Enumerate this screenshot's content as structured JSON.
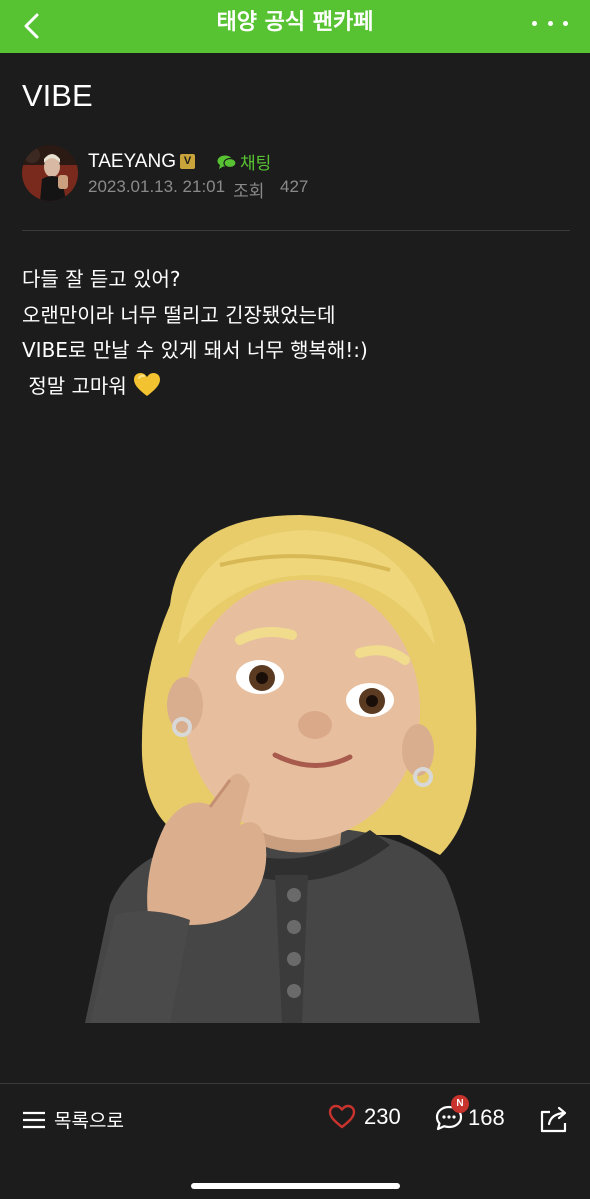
{
  "header": {
    "title": "태양 공식 팬카페",
    "back_icon": "chevron-left-icon",
    "more_icon": "more-dots-icon",
    "bg_color": "#58c332"
  },
  "post": {
    "title": "VIBE",
    "author": {
      "name": "TAEYANG",
      "verified_badge": "V",
      "chat_label": "채팅"
    },
    "date": "2023.01.13. 21:01",
    "views_label": "조회",
    "views": "427",
    "body_lines": [
      "다들 잘 듣고 있어?",
      "오랜만이라 너무 떨리고 긴장됐었는데",
      "VIBE로 만날 수 있게 돼서 너무 행복해!:)",
      " 정말 고마워"
    ],
    "emoji": "yellow-heart-icon"
  },
  "footer": {
    "list_label": "목록으로",
    "likes": "230",
    "comments": "168",
    "new_badge": "N",
    "accent_like": "#c8332e"
  }
}
